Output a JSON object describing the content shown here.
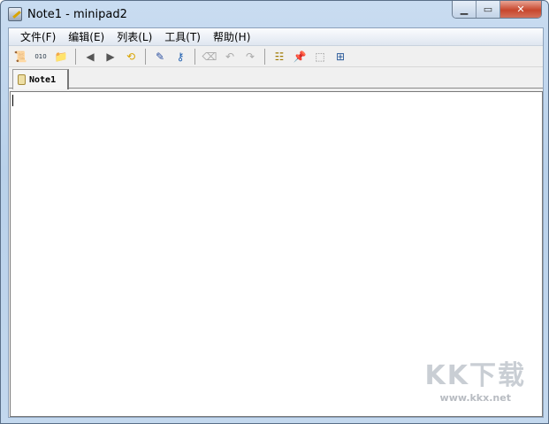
{
  "window": {
    "title": "Note1 - minipad2"
  },
  "menu": [
    "文件(F)",
    "编辑(E)",
    "列表(L)",
    "工具(T)",
    "帮助(H)"
  ],
  "toolbar": [
    {
      "name": "new-note-icon",
      "glyph": "📜"
    },
    {
      "name": "binary-file-icon",
      "glyph": "010"
    },
    {
      "name": "open-folder-icon",
      "glyph": "📁"
    },
    {
      "sep": true
    },
    {
      "name": "back-icon",
      "glyph": "◀"
    },
    {
      "name": "forward-icon",
      "glyph": "▶"
    },
    {
      "name": "refresh-icon",
      "glyph": "⟲"
    },
    {
      "sep": true
    },
    {
      "name": "font-pen-icon",
      "glyph": "✎"
    },
    {
      "name": "key-icon",
      "glyph": "⚷"
    },
    {
      "sep": true
    },
    {
      "name": "eraser-icon",
      "glyph": "⌫"
    },
    {
      "name": "undo-icon",
      "glyph": "↶"
    },
    {
      "name": "redo-icon",
      "glyph": "↷"
    },
    {
      "sep": true
    },
    {
      "name": "tree-icon",
      "glyph": "☷"
    },
    {
      "name": "pin-icon",
      "glyph": "📌"
    },
    {
      "name": "select-icon",
      "glyph": "⬚"
    },
    {
      "name": "insert-icon",
      "glyph": "⊞"
    }
  ],
  "tabs": [
    {
      "label": "Note1"
    }
  ],
  "watermark": {
    "logo": "KK下载",
    "url": "www.kkx.net"
  }
}
